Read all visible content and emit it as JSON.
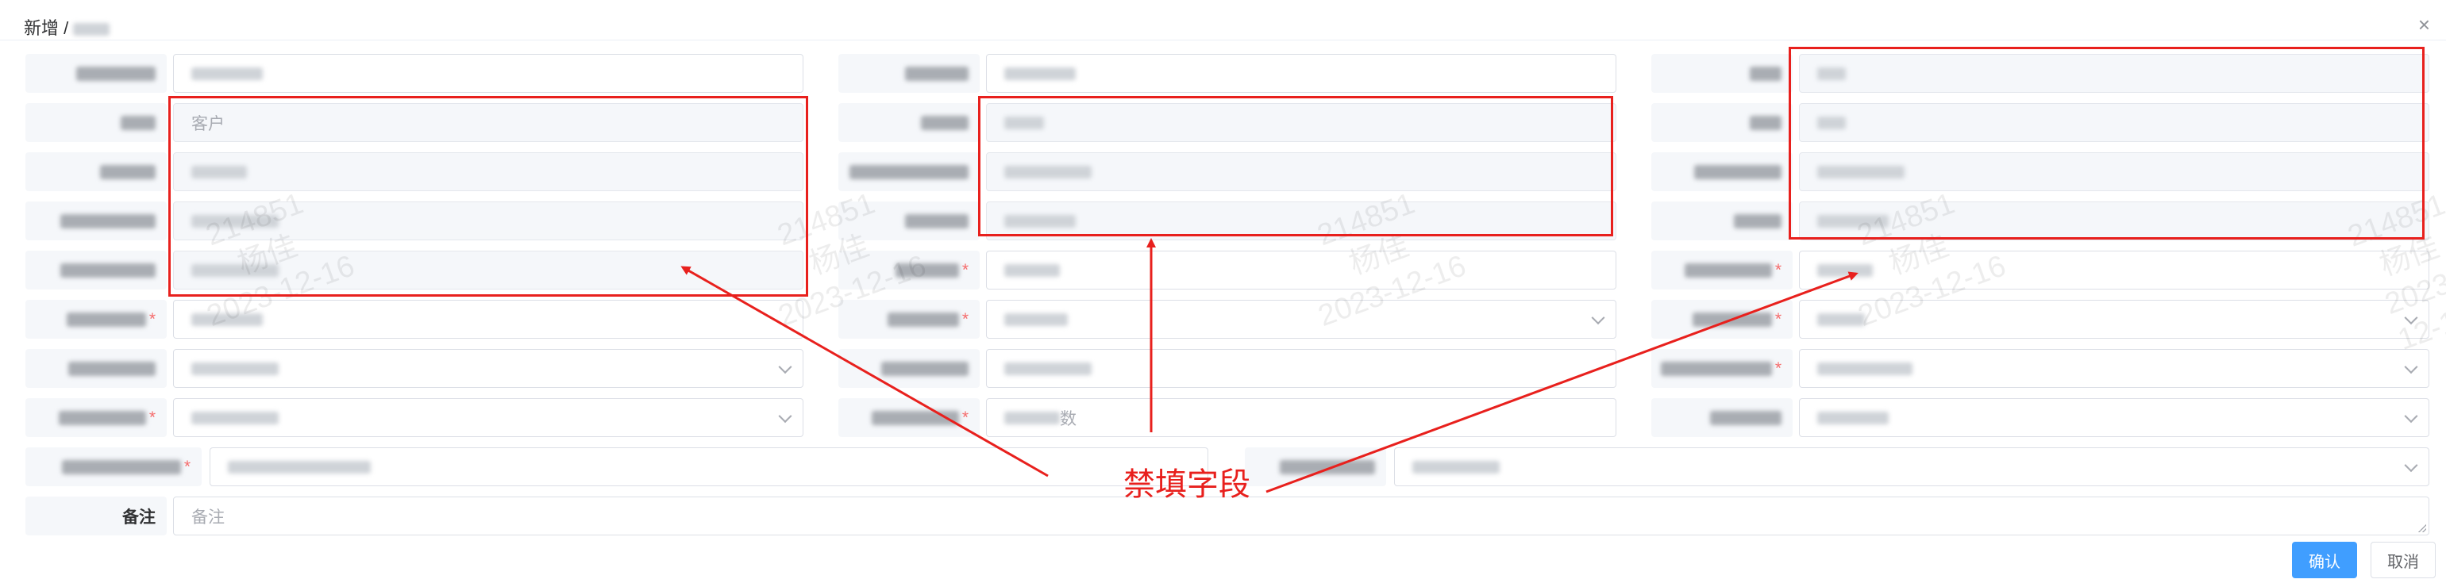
{
  "dialog": {
    "title": "新增 /",
    "close_icon": "×"
  },
  "fields": {
    "customer_placeholder": "客户",
    "number_placeholder": "数",
    "remark_label": "备注",
    "remark_placeholder": "备注"
  },
  "annotation": {
    "text": "禁填字段",
    "color": "#e8201d"
  },
  "watermark": {
    "lines": [
      "214851",
      "杨佳",
      "2023-12-16"
    ]
  },
  "footer": {
    "confirm_label": "确认",
    "cancel_label": "取消"
  }
}
